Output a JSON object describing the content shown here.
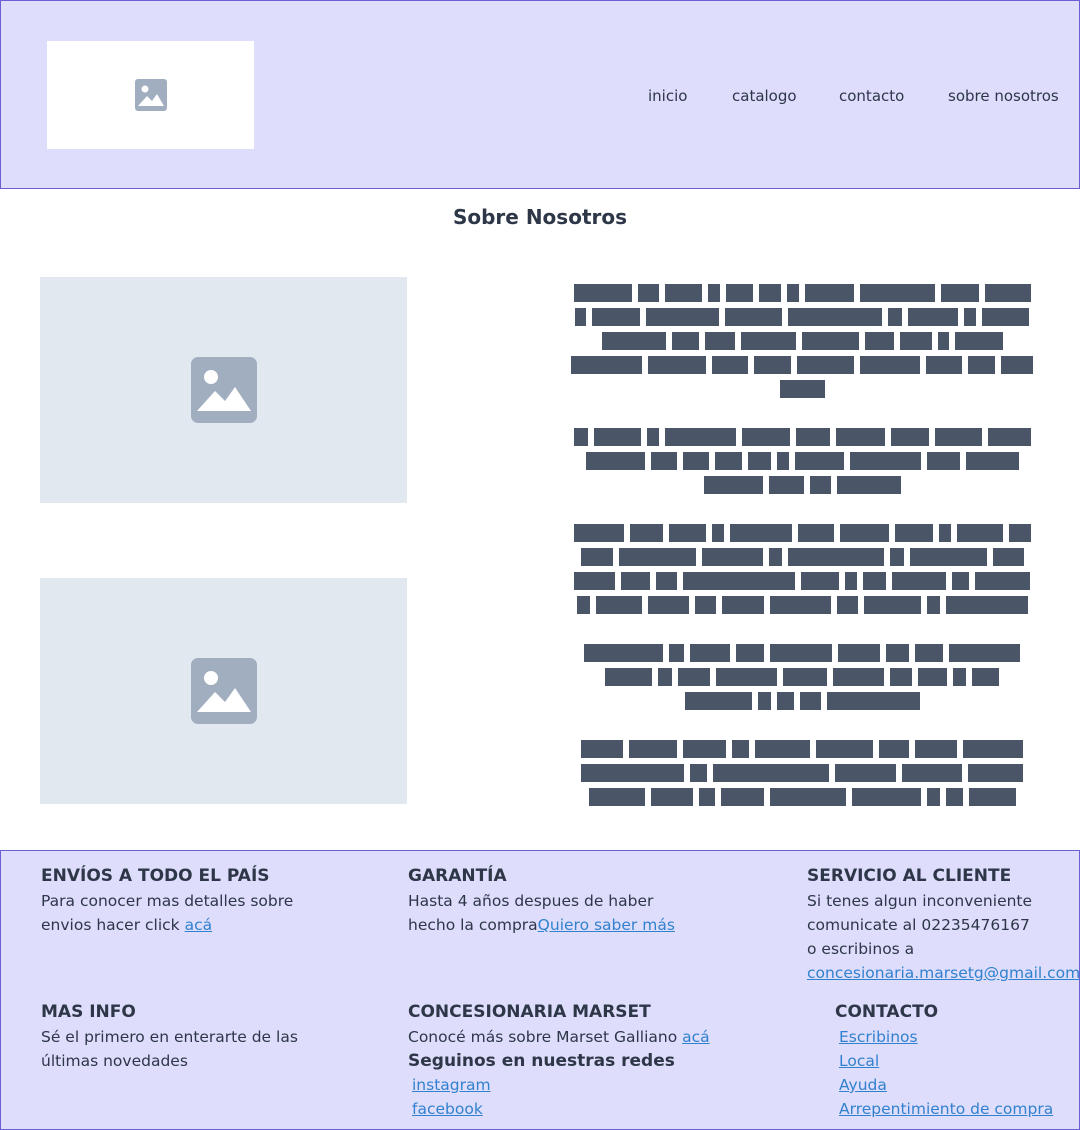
{
  "header": {
    "logo_icon": "image-placeholder-icon",
    "nav": [
      {
        "label": "inicio"
      },
      {
        "label": "catalogo"
      },
      {
        "label": "contacto"
      },
      {
        "label": "sobre nosotros"
      }
    ]
  },
  "main": {
    "title": "Sobre Nosotros",
    "images": [
      {
        "icon": "image-placeholder-icon"
      },
      {
        "icon": "image-placeholder-icon"
      }
    ]
  },
  "footer": {
    "envios": {
      "title": "ENVÍOS A TODO EL PAÍS",
      "text1": "Para conocer mas detalles sobre",
      "text2": "envios hacer click ",
      "link": "acá"
    },
    "garantia": {
      "title": "GARANTÍA",
      "text1": "Hasta 4 años despues de haber",
      "text2": "hecho la compra",
      "link": "Quiero saber más"
    },
    "servicio": {
      "title": "SERVICIO AL CLIENTE",
      "text1": "Si tenes algun inconveniente",
      "text2": "comunicate al 02235476167",
      "text3": "o escribinos a",
      "email": "concesionaria.marsetg@gmail.com"
    },
    "masinfo": {
      "title": "MAS INFO",
      "text1": "Sé el primero en enterarte de las",
      "text2": "últimas novedades"
    },
    "concesionaria": {
      "title": "CONCESIONARIA MARSET",
      "text1": "Conocé más sobre Marset Galliano ",
      "link": "acá",
      "redes_title": "Seguinos en nuestras redes",
      "redes": [
        "instagram",
        "facebook"
      ]
    },
    "contacto": {
      "title": "CONTACTO",
      "links": [
        "Escribinos",
        "Local",
        "Ayuda",
        "Arrepentimiento de compra"
      ]
    }
  },
  "colors": {
    "header_bg": "#dfddfc",
    "border": "#6b5fd6",
    "text": "#2d3748",
    "link": "#3182ce",
    "placeholder_bg": "#e2e8f0",
    "placeholder_icon": "#a0aec0",
    "redacted_text": "#4a5568"
  }
}
